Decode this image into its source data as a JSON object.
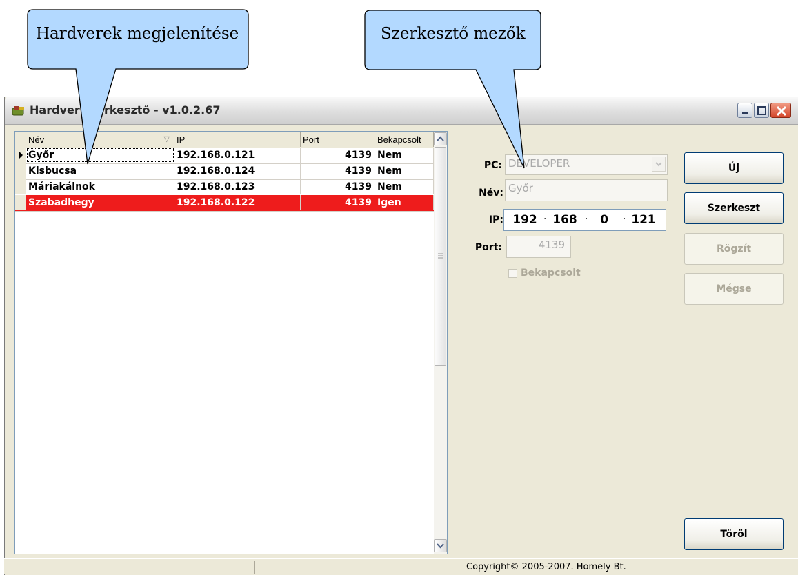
{
  "window": {
    "title": "Hardver szerkesztő - v1.0.2.67"
  },
  "grid": {
    "columns": [
      "Név",
      "IP",
      "Port",
      "Bekapcsolt"
    ],
    "rows": [
      {
        "name": "Győr",
        "ip": "192.168.0.121",
        "port": "4139",
        "on": "Nem"
      },
      {
        "name": "Kisbucsa",
        "ip": "192.168.0.124",
        "port": "4139",
        "on": "Nem"
      },
      {
        "name": "Máriakálnok",
        "ip": "192.168.0.123",
        "port": "4139",
        "on": "Nem"
      },
      {
        "name": "Szabadhegy",
        "ip": "192.168.0.122",
        "port": "4139",
        "on": "Igen"
      }
    ]
  },
  "editor": {
    "pc_label": "PC:",
    "pc_value": "DEVELOPER",
    "name_label": "Név:",
    "name_value": "Győr",
    "ip_label": "IP:",
    "ip_octets": [
      "192",
      "168",
      "0",
      "121"
    ],
    "port_label": "Port:",
    "port_value": "4139",
    "checkbox_label": "Bekapcsolt"
  },
  "buttons": {
    "new": "Új",
    "edit": "Szerkeszt",
    "save": "Rögzít",
    "cancel": "Mégse",
    "delete": "Töröl"
  },
  "statusbar": {
    "copyright": "Copyright© 2005-2007. Homely Bt."
  },
  "callouts": {
    "list": "Hardverek megjelenítése",
    "editor": "Szerkesztő mezők"
  },
  "colors": {
    "selected_row": "#ee1c1c",
    "callout_fill": "#b3d9ff"
  }
}
